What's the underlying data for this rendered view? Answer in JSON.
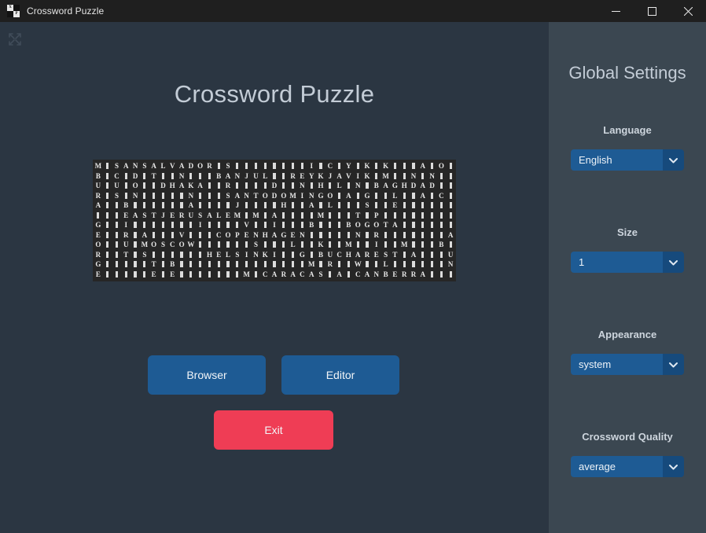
{
  "window": {
    "title": "Crossword Puzzle",
    "icon_name": "crossword-app-icon",
    "icon_letters": [
      "X",
      "P"
    ],
    "controls": {
      "minimize": "minimize",
      "maximize": "maximize",
      "close": "close"
    }
  },
  "main": {
    "expand_icon": "fullscreen-expand-icon",
    "title": "Crossword Puzzle",
    "buttons": {
      "browser": "Browser",
      "editor": "Editor",
      "exit": "Exit"
    },
    "colors": {
      "background": "#2b3642",
      "primary_button": "#1e5b94",
      "danger_button": "#ef3d55",
      "title_text": "#c3ccd6",
      "grid_background": "#262626",
      "grid_letter": "#e9e9e9"
    }
  },
  "crossword": {
    "rows": 12,
    "cols": 39,
    "words": [
      "SAN SALVADOR",
      "BANJUL",
      "REYKJAVIK",
      "DHAKA",
      "BAGHDAD",
      "SANTO DOMINGO",
      "EAST JERUSALEM",
      "BOGOTA",
      "COPENHAGEN",
      "MOSCOW",
      "HELSINKI",
      "BUCHAREST",
      "CARACAS",
      "CANBERRA"
    ],
    "grid": [
      "M.SANSALVADOR.S........I.C.Y.K.K...A.O.",
      "B.C.D.T..N...BANJUL..REYKJAVIK.M..N.N.",
      "U.U.O..DHAKA..R....D..N.H.L.N.BAGHDAD.",
      "R.S.N.....N...SANTODOMINGO.A.G..L..A.C.",
      "A..B......A....J....H..A.L...S..E......",
      "...EASTJERUSALEM.M.A....M...T.P........",
      "G..I.......I....V..I...B...BOGOTA......",
      "E..R.A...V...COPENHAGEN.....N.R.......A",
      "O..U.MOSCOW......S...L..K..M..I..M...B",
      "R..T.S......HELSINKI..G.BUCHAREST.A...U",
      "G.....T.B..............M.R..W..L......N...J",
      "E.....E.E.......M.CARACAS.A.CANBERRA...A"
    ]
  },
  "sidebar": {
    "title": "Global Settings",
    "background": "#3b4751",
    "settings": [
      {
        "label": "Language",
        "value": "English",
        "name": "language"
      },
      {
        "label": "Size",
        "value": "1",
        "name": "size"
      },
      {
        "label": "Appearance",
        "value": "system",
        "name": "appearance"
      },
      {
        "label": "Crossword Quality",
        "value": "average",
        "name": "crossword-quality"
      }
    ]
  }
}
